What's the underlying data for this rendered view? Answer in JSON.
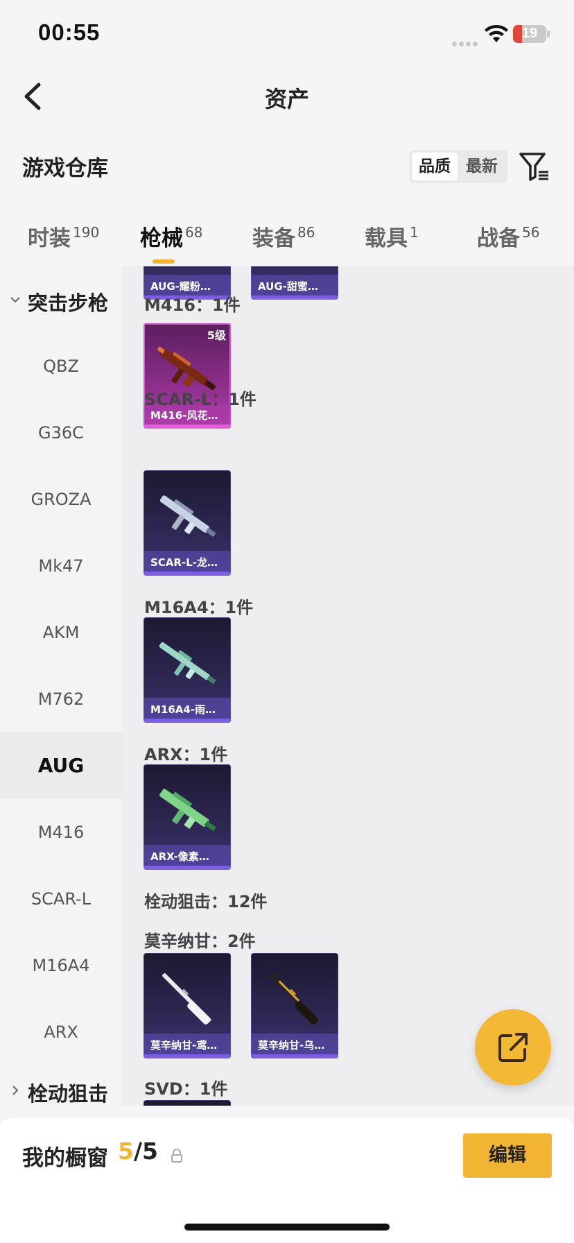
{
  "status_bar": {
    "time": "00:55",
    "battery": "19",
    "battery_level": 0.19
  },
  "navbar": {
    "title": "资产"
  },
  "warehouse": {
    "label": "游戏仓库",
    "sort_options": [
      "品质",
      "最新"
    ],
    "active_sort": "品质"
  },
  "tabs": [
    {
      "label": "时装",
      "count": "190"
    },
    {
      "label": "枪械",
      "count": "68",
      "active": true
    },
    {
      "label": "装备",
      "count": "86"
    },
    {
      "label": "载具",
      "count": "1"
    },
    {
      "label": "战备",
      "count": "56"
    }
  ],
  "sidebar": {
    "group_1": "突击步枪",
    "items": [
      "QBZ",
      "G36C",
      "GROZA",
      "Mk47",
      "AKM",
      "M762",
      "AUG",
      "M416",
      "SCAR-L",
      "M16A4",
      "ARX"
    ],
    "active_item": "AUG",
    "group_2": "栓动狙击"
  },
  "content": {
    "top_cards": [
      "AUG-耀粉…",
      "AUG-甜蜜…"
    ],
    "groups": [
      {
        "title": "M416：1件",
        "cards": [
          {
            "name": "M416-风花…",
            "level": "5级",
            "quality": "pink"
          }
        ]
      },
      {
        "title": "SCAR-L：1件",
        "cards": [
          {
            "name": "SCAR-L-龙…"
          }
        ]
      },
      {
        "title": "M16A4：1件",
        "cards": [
          {
            "name": "M16A4-雨…"
          }
        ]
      },
      {
        "title": "ARX：1件",
        "cards": [
          {
            "name": "ARX-像素…"
          }
        ]
      },
      {
        "title": "栓动狙击：12件"
      },
      {
        "title": "莫辛纳甘：2件",
        "cards": [
          {
            "name": "莫辛纳甘-鸢…"
          },
          {
            "name": "莫辛纳甘-乌…"
          }
        ]
      },
      {
        "title": "SVD：1件"
      }
    ]
  },
  "footer": {
    "showcase_label": "我的橱窗",
    "showcase_used": "5",
    "showcase_total": "/5",
    "edit_label": "编辑"
  },
  "colors": {
    "accent": "#f2b533",
    "card_purple": "#2c2650",
    "card_pink": "#8a2d88"
  }
}
